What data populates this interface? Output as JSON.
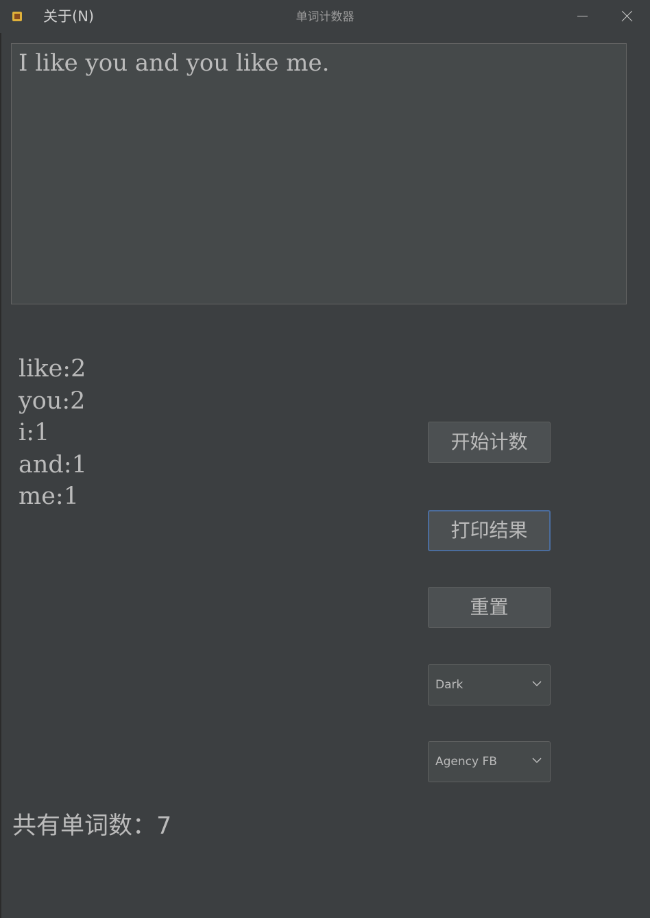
{
  "titlebar": {
    "menu_about": "关于(N)",
    "window_title": "单词计数器",
    "app_icon": "app-icon",
    "minimize_icon": "minimize-icon",
    "close_icon": "close-icon"
  },
  "input": {
    "value": "I like you and you like me."
  },
  "results": [
    "like:2",
    "you:2",
    "i:1",
    "and:1",
    "me:1"
  ],
  "buttons": {
    "start_count": "开始计数",
    "print_result": "打印结果",
    "reset": "重置"
  },
  "theme_select": {
    "selected": "Dark"
  },
  "font_select": {
    "selected": "Agency FB"
  },
  "total": {
    "label": "共有单词数：",
    "value": "7"
  },
  "colors": {
    "background": "#3c3f41",
    "text": "#bbbbbb",
    "textarea_bg": "#45494a",
    "button_bg": "#4c5052",
    "focus_border": "#4b6d9e"
  }
}
